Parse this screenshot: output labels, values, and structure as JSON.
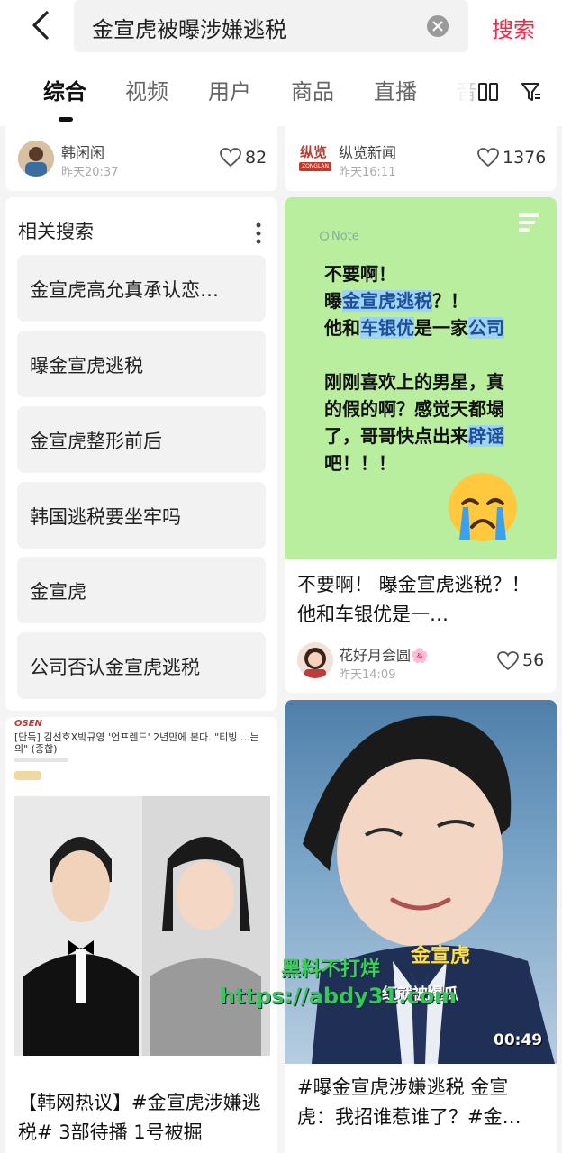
{
  "header": {
    "query": "金宣虎被曝涉嫌逃税",
    "search_label": "搜索",
    "tabs": [
      "综合",
      "视频",
      "用户",
      "商品",
      "直播",
      "音"
    ]
  },
  "top_cards": [
    {
      "author": "韩闲闲",
      "time": "昨天20:37",
      "likes": "82"
    },
    {
      "author": "纵览新闻",
      "time": "昨天16:11",
      "likes": "1376",
      "logo_text": "纵览",
      "logo_sub": "ZONGLAN"
    }
  ],
  "related": {
    "title": "相关搜索",
    "items": [
      "金宣虎高允真承认恋…",
      "曝金宣虎逃税",
      "金宣虎整形前后",
      "韩国逃税要坐牢吗",
      "金宣虎",
      "公司否认金宣虎逃税"
    ]
  },
  "note_card": {
    "label": "Note",
    "lines": [
      "不要啊！",
      "曝金宣虎逃税？！",
      "他和车银优是一家公司",
      "",
      "刚刚喜欢上的男星，真",
      "的假的啊？感觉天都塌",
      "了，哥哥快点出来辟谣",
      "吧！！！"
    ],
    "title": "不要啊！ 曝金宣虎逃税？！ 他和车银优是一…",
    "author": "花好月会圆🌸",
    "time": "昨天14:09",
    "likes": "56"
  },
  "news_card": {
    "brand": "OSEN",
    "headline": "[단독] 김선호X박규영 '언프렌드' 2년만에 본다..\"티빙 ...는 의\" (종합)",
    "title": "【韩网热议】#金宣虎涉嫌逃税# 3部待播 1号被掘"
  },
  "video_card": {
    "overlay_top": "金宣虎",
    "overlay_bottom": "红就被爆瓜",
    "duration": "00:49",
    "title": "#曝金宣虎涉嫌逃税 金宣虎：我招谁惹谁了？#金…"
  },
  "watermark": {
    "line1": "黑料不打烊",
    "line2": "https://abdy31.com"
  },
  "colors": {
    "accent": "#ff2442",
    "note_bg": "#b9ee9e",
    "highlight": "#9fd3f4"
  }
}
